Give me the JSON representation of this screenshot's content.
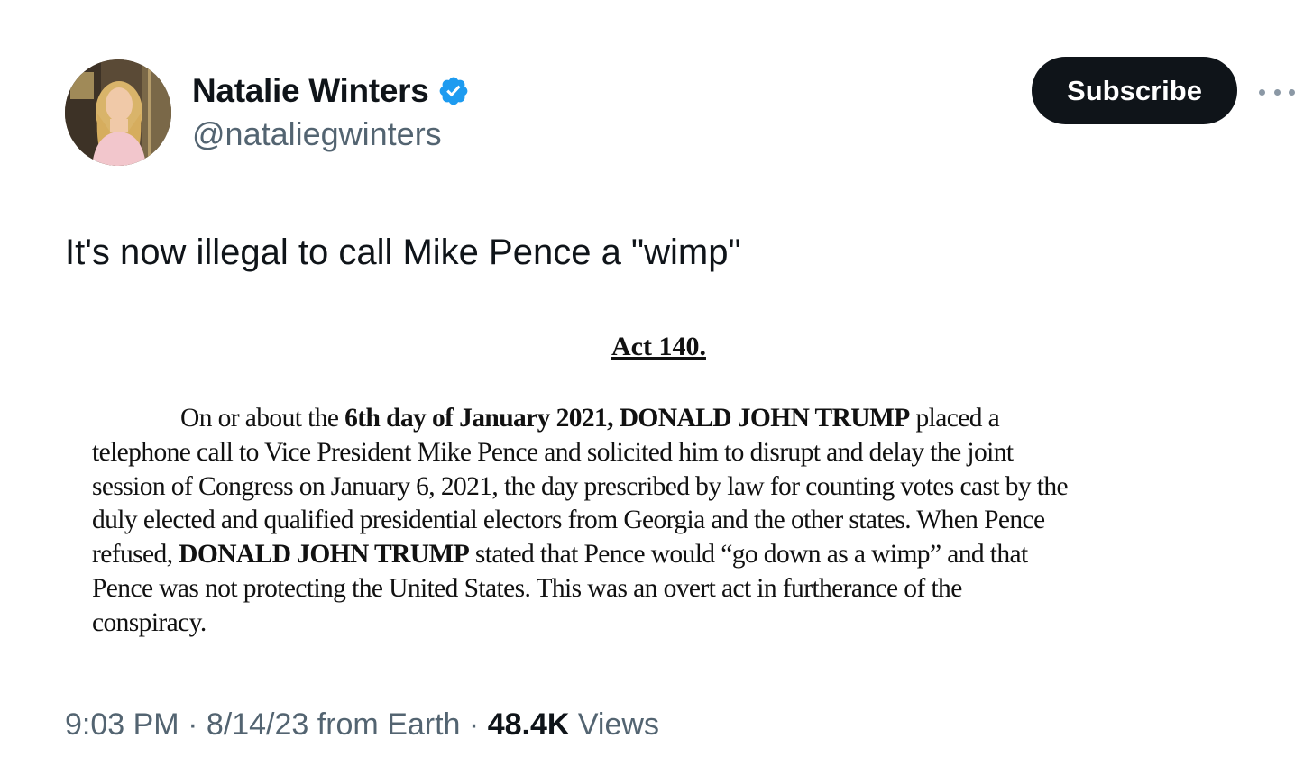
{
  "author": {
    "display_name": "Natalie Winters",
    "handle": "@nataliegwinters",
    "verified_icon": "verified-badge-icon",
    "verified_color": "#1d9bf0"
  },
  "actions": {
    "subscribe_label": "Subscribe",
    "more_icon": "more-horizontal-icon"
  },
  "tweet": {
    "text": "It's now illegal to call Mike Pence a \"wimp\""
  },
  "document": {
    "heading": "Act 140.",
    "lines": [
      [
        "On or about the ",
        "6th day of January 2021, DONALD JOHN TRUMP",
        " placed a"
      ],
      [
        "telephone call to Vice President Mike Pence and solicited him to disrupt and delay the joint"
      ],
      [
        "session of Congress on January 6, 2021, the day prescribed by law for counting votes cast by the"
      ],
      [
        "duly elected and qualified presidential electors from Georgia and the other states. When Pence"
      ],
      [
        "refused, ",
        "DONALD JOHN TRUMP",
        " stated that Pence would “go down as a wimp” and that"
      ],
      [
        "Pence was not protecting the United States. This was an overt act in furtherance of the"
      ],
      [
        "conspiracy."
      ]
    ]
  },
  "meta": {
    "time": "9:03 PM",
    "separator": " · ",
    "date": "8/14/23",
    "source": " from Earth",
    "views_count": "48.4K",
    "views_label": " Views"
  },
  "colors": {
    "text_primary": "#0f1419",
    "text_secondary": "#536471",
    "button_bg": "#0f1419"
  }
}
